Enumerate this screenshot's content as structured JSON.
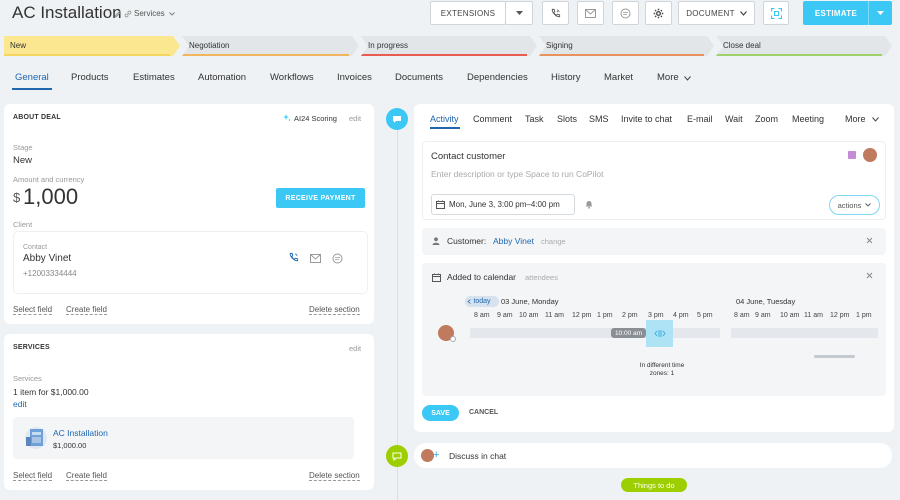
{
  "header": {
    "title": "AC Installation",
    "subtitle": "Services",
    "buttons": {
      "extensions": "EXTENSIONS",
      "document": "DOCUMENT",
      "estimate": "ESTIMATE"
    }
  },
  "stages": [
    {
      "label": "New",
      "bg": "#fbe78f",
      "line": "#f2d65f"
    },
    {
      "label": "Negotiation",
      "bg": "#e3e6e9",
      "line": "#f3b45f"
    },
    {
      "label": "In progress",
      "bg": "#e3e6e9",
      "line": "#e85b4f"
    },
    {
      "label": "Signing",
      "bg": "#e3e6e9",
      "line": "#e8935f"
    },
    {
      "label": "Close deal",
      "bg": "#e3e6e9",
      "line": "#9fd069"
    }
  ],
  "tabs": [
    "General",
    "Products",
    "Estimates",
    "Automation",
    "Workflows",
    "Invoices",
    "Documents",
    "Dependencies",
    "History",
    "Market",
    "More"
  ],
  "about": {
    "title": "ABOUT DEAL",
    "scoring": "AI24 Scoring",
    "edit": "edit",
    "stage_label": "Stage",
    "stage_value": "New",
    "amount_label": "Amount and currency",
    "currency": "$",
    "amount": "1,000",
    "receive_payment": "RECEIVE PAYMENT",
    "client_label": "Client",
    "contact_label": "Contact",
    "contact_name": "Abby Vinet",
    "contact_phone": "+12003334444",
    "select_field": "Select field",
    "create_field": "Create field",
    "delete_section": "Delete section"
  },
  "services": {
    "title": "SERVICES",
    "edit": "edit",
    "label": "Services",
    "summary": "1 item for $1,000.00",
    "edit_link": "edit",
    "item_name": "AC Installation",
    "item_price": "$1,000.00",
    "select_field": "Select field",
    "create_field": "Create field",
    "delete_section": "Delete section"
  },
  "activity": {
    "tabs": [
      "Activity",
      "Comment",
      "Task",
      "Slots",
      "SMS",
      "Invite to chat",
      "E-mail",
      "Wait",
      "Zoom",
      "Meeting",
      "More"
    ],
    "subject": "Contact customer",
    "description_placeholder": "Enter description or type Space to run CoPilot",
    "datetime": "Mon, June 3, 3:00 pm–4:00 pm",
    "actions": "actions",
    "customer_label": "Customer:",
    "customer_name": "Abby Vinet",
    "customer_change": "change",
    "calendar_title": "Added to calendar",
    "calendar_attendees": "attendees",
    "today": "today",
    "day1": "03 June, Monday",
    "day2": "04 June, Tuesday",
    "hours1": [
      "8 am",
      "9 am",
      "10 am",
      "11 am",
      "12 pm",
      "1 pm",
      "2 pm",
      "3 pm",
      "4 pm",
      "5 pm"
    ],
    "hours2": [
      "8 am",
      "9 am",
      "10 am",
      "11 am",
      "12 pm",
      "1 pm"
    ],
    "time_badge": "10:00 am",
    "tz_note_1": "In different time",
    "tz_note_2": "zones: 1",
    "save": "SAVE",
    "cancel": "CANCEL",
    "discuss": "Discuss in chat",
    "things_to_do": "Things to do"
  },
  "colors": {
    "accent": "#3bc8f5",
    "link": "#2067b0",
    "green": "#9dcf00"
  }
}
